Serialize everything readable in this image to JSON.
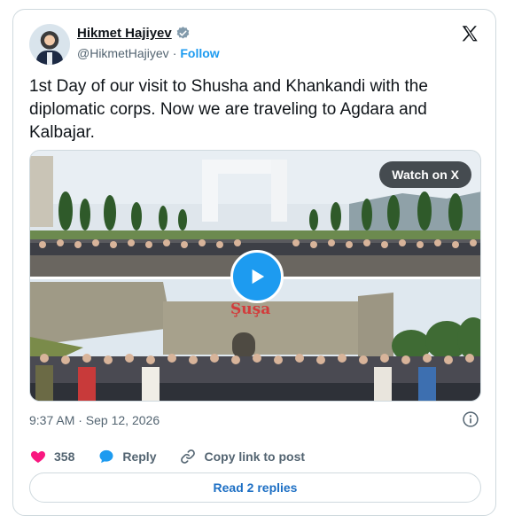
{
  "author": {
    "name": "Hikmet Hajiyev",
    "handle": "@HikmetHajiyev",
    "separator": "·",
    "follow_label": "Follow"
  },
  "tweet": {
    "text": "1st Day of our visit to Shusha and Khankandi with the diplomatic corps. Now we are traveling to Agdara and Kalbajar."
  },
  "media": {
    "watch_label": "Watch on X",
    "banner_text": "Şuşa"
  },
  "meta": {
    "timestamp": "9:37 AM · Sep 12, 2026"
  },
  "actions": {
    "like_count": "358",
    "reply_label": "Reply",
    "copy_label": "Copy link to post"
  },
  "footer": {
    "read_replies_label": "Read 2 replies"
  },
  "colors": {
    "accent": "#1d9bf0",
    "like": "#f91880",
    "muted": "#536471"
  }
}
